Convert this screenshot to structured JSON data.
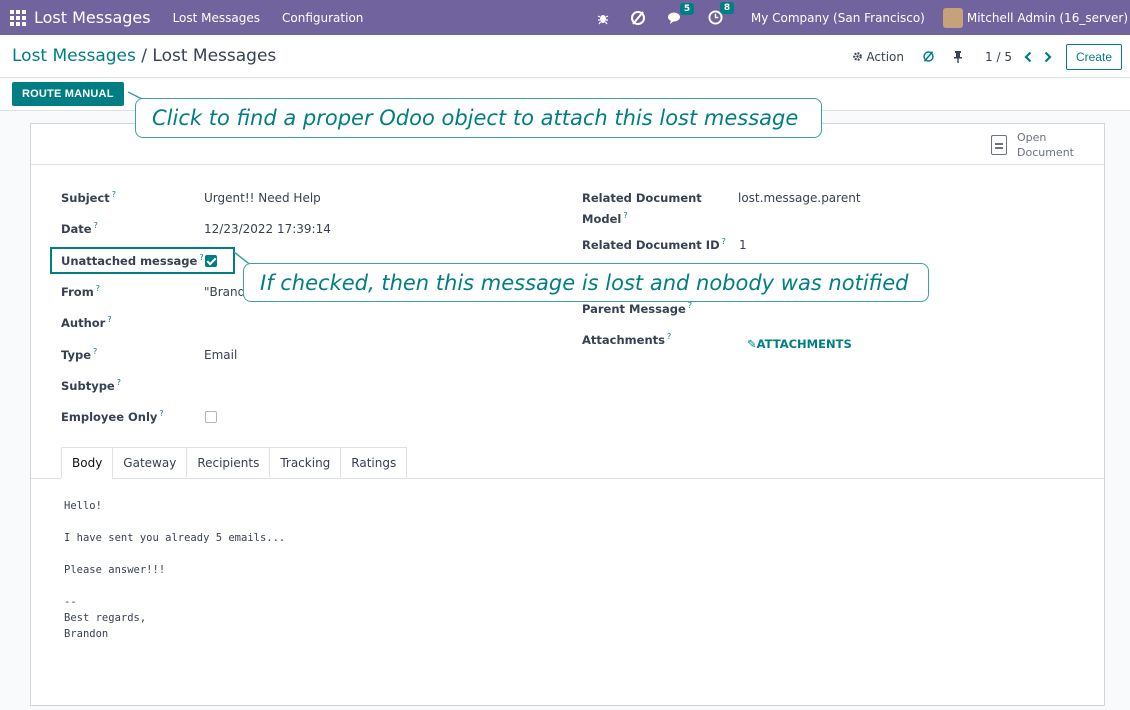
{
  "navbar": {
    "app_title": "Lost Messages",
    "menus": [
      "Lost Messages",
      "Configuration"
    ],
    "chat_count": "5",
    "activity_count": "8",
    "company": "My Company (San Francisco)",
    "user": "Mitchell Admin (16_server)"
  },
  "control": {
    "breadcrumb_parent": "Lost Messages",
    "breadcrumb_sep": " / ",
    "breadcrumb_current": "Lost Messages",
    "action_label": "Action",
    "pager": "1 / 5",
    "create_label": "Create"
  },
  "status": {
    "route_manual_label": "ROUTE MANUAL"
  },
  "sheet": {
    "open_document_line1": "Open",
    "open_document_line2": "Document"
  },
  "fields_left": {
    "subject_label": "Subject",
    "subject_value": "Urgent!! Need Help",
    "date_label": "Date",
    "date_value": "12/23/2022 17:39:14",
    "unattached_label": "Unattached message",
    "from_label": "From",
    "from_value": "\"Brand",
    "author_label": "Author",
    "type_label": "Type",
    "type_value": "Email",
    "subtype_label": "Subtype",
    "employee_only_label": "Employee Only"
  },
  "fields_right": {
    "related_model_label_line1": "Related Document",
    "related_model_label_line2": "Model",
    "related_model_value": "lost.message.parent",
    "related_id_label": "Related Document ID",
    "related_id_value": "1",
    "parent_message_label": "Parent Message",
    "attachments_label": "Attachments",
    "attachments_button": "ATTACHMENTS"
  },
  "help_marker": "?",
  "tabs": [
    "Body",
    "Gateway",
    "Recipients",
    "Tracking",
    "Ratings"
  ],
  "body_lines": [
    "Hello!",
    "",
    "I have sent you already 5 emails...",
    "",
    "Please answer!!!",
    "",
    "--",
    "Best regards,",
    "Brandon"
  ],
  "tooltips": {
    "route_tip": "Click to find a proper Odoo object to attach this lost message",
    "unattached_tip": "If checked, then this message is lost and nobody was notified"
  },
  "colors": {
    "navbar": "#71639e",
    "primary": "#017e84"
  }
}
